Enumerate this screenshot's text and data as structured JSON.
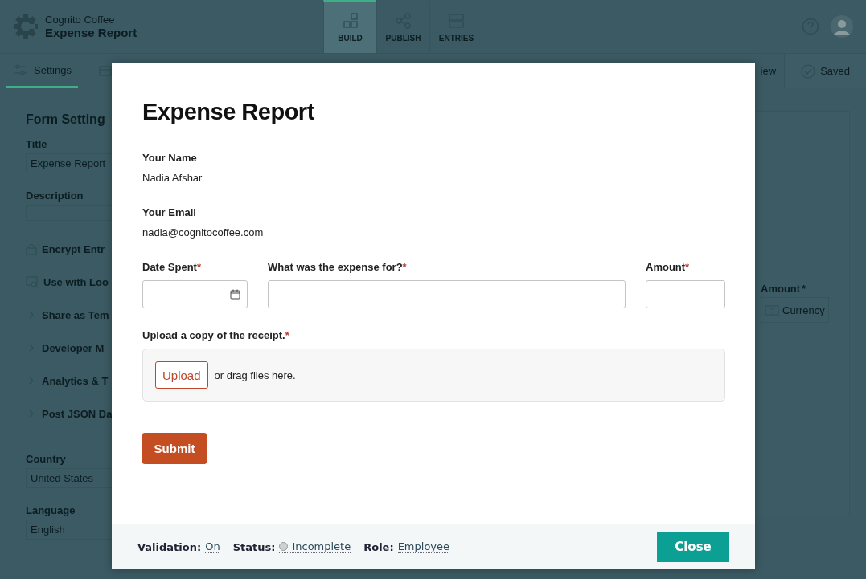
{
  "app_header": {
    "org": "Cognito Coffee",
    "form_title": "Expense Report",
    "tabs": [
      {
        "label": "BUILD",
        "selected": true,
        "kind": "build"
      },
      {
        "label": "PUBLISH",
        "selected": false,
        "kind": "publish"
      },
      {
        "label": "ENTRIES",
        "selected": false,
        "kind": "entries"
      }
    ]
  },
  "toolbar": {
    "tabs": [
      {
        "label": "Settings",
        "selected": true
      }
    ],
    "preview_fragment": "iew",
    "saved": "Saved"
  },
  "settings_panel": {
    "heading": "Form Setting",
    "fields": [
      {
        "label": "Title",
        "value": "Expense Report",
        "kind": "input"
      },
      {
        "label": "Description",
        "kind": "textarea"
      }
    ],
    "options": [
      {
        "label": "Encrypt Entr",
        "kind": "lock"
      },
      {
        "label": "Use with Loo",
        "kind": "lookup"
      },
      {
        "label": "Share as Tem",
        "kind": "expand"
      },
      {
        "label": "Developer M",
        "kind": "expand"
      },
      {
        "label": "Analytics & T",
        "kind": "expand"
      },
      {
        "label": "Post JSON Da",
        "kind": "expand"
      }
    ],
    "locale_fields": [
      {
        "label": "Country",
        "value": "United States"
      },
      {
        "label": "Language",
        "value": "English"
      }
    ]
  },
  "canvas": {
    "field_label": "Amount",
    "required_mark": "*",
    "placeholder": "Currency"
  },
  "modal": {
    "title": "Expense Report",
    "info": [
      {
        "label": "Your Name",
        "value": "Nadia Afshar"
      },
      {
        "label": "Your Email",
        "value": "nadia@cognitocoffee.com"
      }
    ],
    "inputs": [
      {
        "label": "Date Spent",
        "required_mark": "*",
        "kind": "date"
      },
      {
        "label": "What was the expense for?",
        "required_mark": "*",
        "kind": "text"
      },
      {
        "label": "Amount",
        "required_mark": "*",
        "kind": "number"
      }
    ],
    "upload": {
      "label": "Upload a copy of the receipt.",
      "required_mark": "*",
      "button": "Upload",
      "hint": "or drag files here."
    },
    "submit": "Submit",
    "footer": {
      "items": [
        {
          "label": "Validation:",
          "value": "On",
          "kind": "plain"
        },
        {
          "label": "Status:",
          "value": "Incomplete",
          "kind": "status"
        },
        {
          "label": "Role:",
          "value": "Employee",
          "kind": "plain"
        }
      ],
      "close": "Close"
    }
  }
}
